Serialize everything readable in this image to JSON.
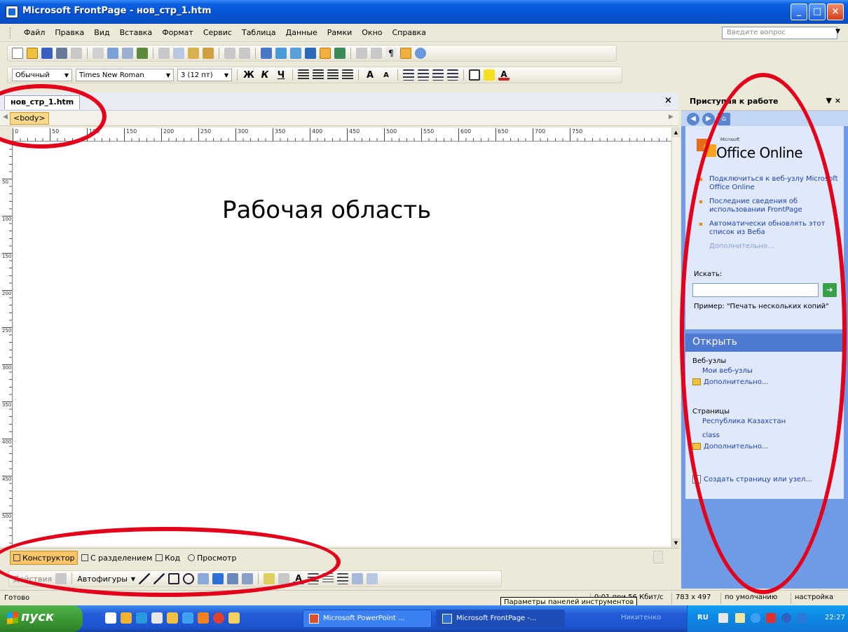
{
  "window": {
    "title": "Microsoft FrontPage - нов_стр_1.htm",
    "buttons": {
      "minimize": "_",
      "maximize": "□",
      "close": "×"
    }
  },
  "menu": {
    "items": [
      "Файл",
      "Правка",
      "Вид",
      "Вставка",
      "Формат",
      "Сервис",
      "Таблица",
      "Данные",
      "Рамки",
      "Окно",
      "Справка"
    ],
    "help_placeholder": "Введите вопрос"
  },
  "format_toolbar": {
    "style": "Обычный",
    "font": "Times New Roman",
    "size": "3 (12 пт)",
    "bold": "Ж",
    "italic": "К",
    "underline": "Ч"
  },
  "document": {
    "tab": "нов_стр_1.htm",
    "tag": "<body>",
    "work_area_label": "Рабочая область",
    "ruler_marks": [
      "0",
      "50",
      "100",
      "150",
      "200",
      "250",
      "300",
      "350",
      "400",
      "450",
      "500",
      "550",
      "600",
      "650",
      "700",
      "750"
    ],
    "vruler_marks": [
      "50",
      "100",
      "150",
      "200",
      "250",
      "300",
      "350",
      "400",
      "450",
      "500"
    ],
    "views": [
      "Конструктор",
      "С разделением",
      "Код",
      "Просмотр"
    ],
    "active_view": "Конструктор"
  },
  "drawing_toolbar": {
    "actions": "Действия",
    "autoshapes": "Автофигуры"
  },
  "task_pane": {
    "title": "Приступая к работе",
    "office_online_small": "Microsoft",
    "office_online": "Office Online",
    "links": [
      "Подключиться к веб-узлу Microsoft Office Online",
      "Последние сведения об использовании FrontPage",
      "Автоматически обновлять этот список из Веба"
    ],
    "more": "Дополнительно...",
    "search_label": "Искать:",
    "example": "Пример: \"Печать нескольких копий\"",
    "open_header": "Открыть",
    "websites_label": "Веб-узлы",
    "my_websites": "Мои веб-узлы",
    "websites_more": "Дополнительно...",
    "pages_label": "Страницы",
    "page_links": [
      "Республика Казахстан",
      "class"
    ],
    "pages_more": "Дополнительно...",
    "create": "Создать страницу или узел..."
  },
  "status": {
    "ready": "Готово",
    "speed": "0:01 при 56 Кбит/с",
    "dimensions": "783 x 497",
    "default": "по умолчанию",
    "custom": "настройка",
    "tooltip": "Параметры панелей инструментов"
  },
  "taskbar": {
    "start": "пуск",
    "windows": [
      "Microsoft PowerPoint ...",
      "Microsoft FrontPage -..."
    ],
    "user": "Никитенко",
    "language": "RU",
    "clock": "22:27"
  },
  "colors": {
    "annotation": "#e4001a",
    "xp_blue": "#0a5fe0",
    "active_view": "#f9c56a"
  }
}
